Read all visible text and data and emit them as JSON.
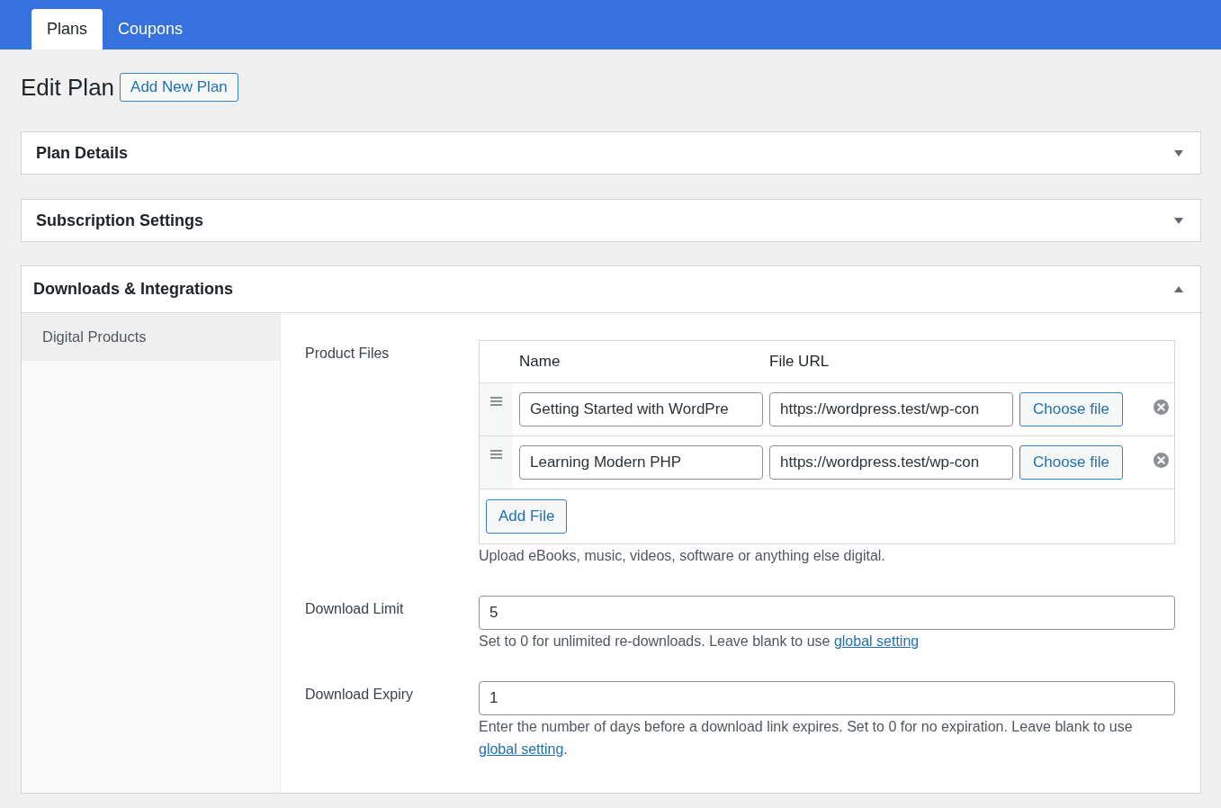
{
  "tabs": [
    {
      "label": "Plans",
      "selected": true
    },
    {
      "label": "Coupons",
      "selected": false
    }
  ],
  "page": {
    "title": "Edit Plan",
    "add_button": "Add New Plan"
  },
  "panels": [
    {
      "title": "Plan Details",
      "expanded": false
    },
    {
      "title": "Subscription Settings",
      "expanded": false
    },
    {
      "title": "Downloads & Integrations",
      "expanded": true,
      "sidebar": {
        "items": [
          {
            "label": "Digital Products",
            "selected": true
          }
        ]
      },
      "fields": [
        {
          "kind": "files",
          "label": "Product Files",
          "columns": [
            "Name",
            "File URL"
          ],
          "rows": [
            {
              "name": "Getting Started with WordPre",
              "url": "https://wordpress.test/wp-con",
              "button": "Choose file"
            },
            {
              "name": "Learning Modern PHP",
              "url": "https://wordpress.test/wp-con",
              "button": "Choose file"
            }
          ],
          "add_button": "Add File",
          "help": "Upload eBooks, music, videos, software or anything else digital."
        },
        {
          "kind": "number",
          "label": "Download Limit",
          "value": "5",
          "help": "Set to 0 for unlimited re-downloads. Leave blank to use ",
          "link": "global setting"
        },
        {
          "kind": "number",
          "label": "Download Expiry",
          "value": "1",
          "help": "Enter the number of days before a download link expires. Set to 0 for no expiration. Leave blank to use ",
          "link": "global setting",
          "help_after": "."
        }
      ]
    }
  ]
}
